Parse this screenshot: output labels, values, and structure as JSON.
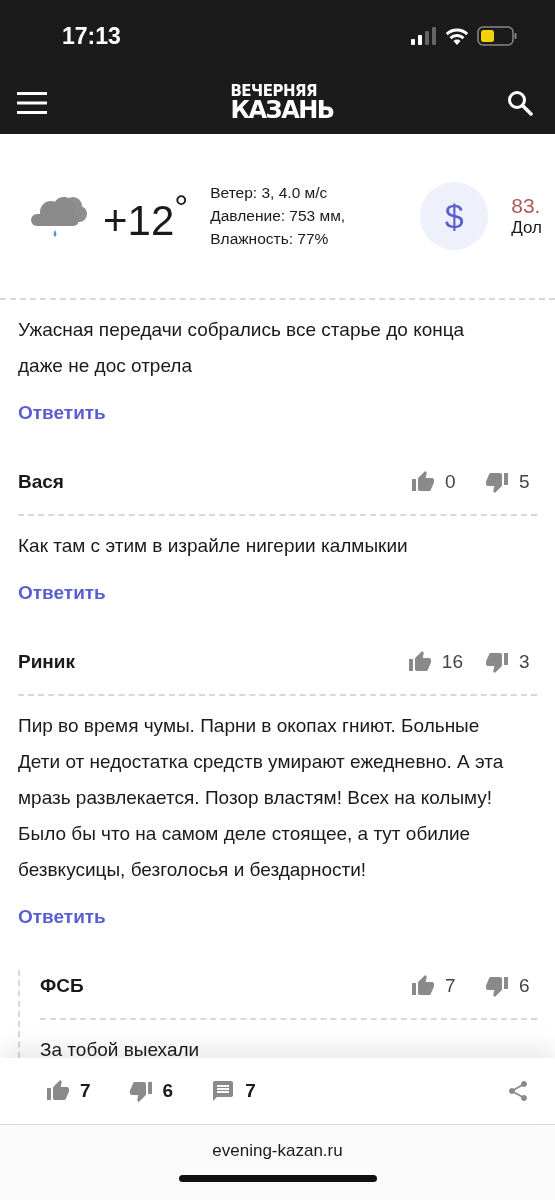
{
  "status_bar": {
    "time": "17:13"
  },
  "header": {
    "logo_line_1": "ВЕЧЕРНЯЯ",
    "logo_line_2": "КАЗАНЬ"
  },
  "weather": {
    "temperature": "+12$^{°}$",
    "details": [
      "Ветер: 3, 4.0 м/с",
      "Давление: 753 мм,",
      "Влажность: 77%"
    ]
  },
  "currency": {
    "symbol": "$",
    "rate": "83.",
    "name": "Дол"
  },
  "comments": [
    {
      "text": "Ужасная передачи собрались все старье до конца даже не дос отрела",
      "reply_label": "Ответить"
    },
    {
      "author": "Вася",
      "likes": "0",
      "dislikes": "5",
      "text": "Как там с этим в израйле нигерии калмыкии",
      "reply_label": "Ответить"
    },
    {
      "author": "Риник",
      "likes": "16",
      "dislikes": "3",
      "text": "Пир во время чумы. Парни в окопах гниют. Больные Дети от недостатка средств умирают ежедневно. А эта мразь развлекается. Позор властям! Всех на колыму! Было бы что на самом деле стоящее, а тут обилие безвкусицы, безголосья и бездарности!",
      "reply_label": "Ответить",
      "replies": [
        {
          "author": "ФСБ",
          "likes": "7",
          "dislikes": "6",
          "text": "За тобой выехали"
        }
      ]
    }
  ],
  "article_bar": {
    "likes": "7",
    "dislikes": "6",
    "comments": "7"
  },
  "browser": {
    "url": "evening-kazan.ru"
  }
}
